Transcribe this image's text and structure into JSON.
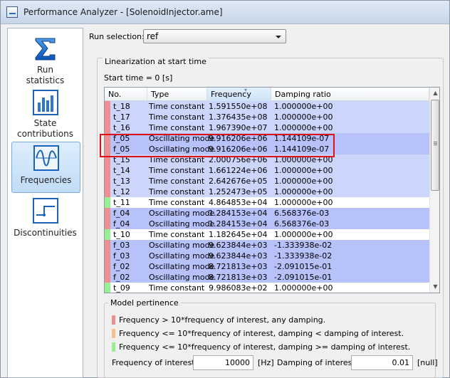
{
  "window": {
    "title": "Performance Analyzer - [SolenoidInjector.ame]",
    "icon": "performance-analyzer-icon"
  },
  "sidebar": {
    "items": [
      {
        "label": "Run\nstatistics",
        "icon": "sigma-icon"
      },
      {
        "label": "State\ncontributions",
        "icon": "bar-chart-icon"
      },
      {
        "label": "Frequencies",
        "icon": "wave-icon",
        "selected": true
      },
      {
        "label": "Discontinuities",
        "icon": "step-icon"
      }
    ]
  },
  "run_selection": {
    "label": "Run selection:",
    "value": "ref"
  },
  "linearization": {
    "title": "Linearization at start time",
    "start_time": "Start time = 0 [s]",
    "columns": [
      "No.",
      "Type",
      "Frequency",
      "Damping ratio"
    ],
    "rows": [
      {
        "no": "t_18",
        "type": "Time constant",
        "freq": "1.591550e+08",
        "damp": "1.000000e+00",
        "pertinence": "red",
        "selected": false
      },
      {
        "no": "t_17",
        "type": "Time constant",
        "freq": "1.376435e+08",
        "damp": "1.000000e+00",
        "pertinence": "red",
        "selected": false
      },
      {
        "no": "t_16",
        "type": "Time constant",
        "freq": "1.967390e+07",
        "damp": "1.000000e+00",
        "pertinence": "red",
        "selected": false
      },
      {
        "no": "f_05",
        "type": "Oscillating mode",
        "freq": "9.916206e+06",
        "damp": "1.144109e-07",
        "pertinence": "red",
        "selected": true
      },
      {
        "no": "f_05",
        "type": "Oscillating mode",
        "freq": "9.916206e+06",
        "damp": "1.144109e-07",
        "pertinence": "red",
        "selected": true
      },
      {
        "no": "t_15",
        "type": "Time constant",
        "freq": "2.000756e+06",
        "damp": "1.000000e+00",
        "pertinence": "red",
        "selected": false
      },
      {
        "no": "t_14",
        "type": "Time constant",
        "freq": "1.661224e+06",
        "damp": "1.000000e+00",
        "pertinence": "red",
        "selected": false
      },
      {
        "no": "t_13",
        "type": "Time constant",
        "freq": "2.642676e+05",
        "damp": "1.000000e+00",
        "pertinence": "red",
        "selected": false
      },
      {
        "no": "t_12",
        "type": "Time constant",
        "freq": "1.252473e+05",
        "damp": "1.000000e+00",
        "pertinence": "red",
        "selected": false
      },
      {
        "no": "t_11",
        "type": "Time constant",
        "freq": "4.864853e+04",
        "damp": "1.000000e+00",
        "pertinence": "green",
        "selected": false
      },
      {
        "no": "f_04",
        "type": "Oscillating mode",
        "freq": "1.284153e+04",
        "damp": "6.568376e-03",
        "pertinence": "red",
        "selected": true
      },
      {
        "no": "f_04",
        "type": "Oscillating mode",
        "freq": "1.284153e+04",
        "damp": "6.568376e-03",
        "pertinence": "red",
        "selected": true
      },
      {
        "no": "t_10",
        "type": "Time constant",
        "freq": "1.182645e+04",
        "damp": "1.000000e+00",
        "pertinence": "green",
        "selected": false
      },
      {
        "no": "f_03",
        "type": "Oscillating mode",
        "freq": "9.623844e+03",
        "damp": "-1.333938e-02",
        "pertinence": "red",
        "selected": true
      },
      {
        "no": "f_03",
        "type": "Oscillating mode",
        "freq": "9.623844e+03",
        "damp": "-1.333938e-02",
        "pertinence": "red",
        "selected": true
      },
      {
        "no": "f_02",
        "type": "Oscillating mode",
        "freq": "8.721813e+03",
        "damp": "-2.091015e-01",
        "pertinence": "red",
        "selected": true
      },
      {
        "no": "f_02",
        "type": "Oscillating mode",
        "freq": "8.721813e+03",
        "damp": "-2.091015e-01",
        "pertinence": "red",
        "selected": true
      },
      {
        "no": "t_09",
        "type": "Time constant",
        "freq": "9.986083e+02",
        "damp": "1.000000e+00",
        "pertinence": "green",
        "selected": false
      }
    ]
  },
  "model_pertinence": {
    "title": "Model pertinence",
    "legend": [
      {
        "color": "#ee8f92",
        "text": "Frequency > 10*frequency of interest, any damping."
      },
      {
        "color": "#f6c08e",
        "text": "Frequency <= 10*frequency of interest, damping < damping of interest."
      },
      {
        "color": "#98ef90",
        "text": "Frequency <= 10*frequency of interest, damping >= damping of interest."
      }
    ],
    "frequency_of_interest": {
      "label": "Frequency of interest:",
      "value": "10000",
      "unit": "[Hz]"
    },
    "damping_of_interest": {
      "label": "Damping of interest:",
      "value": "0.01",
      "unit": "[null]"
    }
  },
  "colors": {
    "marker_red": "#ee8f92",
    "marker_orange": "#f6c08e",
    "marker_green": "#98ef90",
    "row_selected": "#b7c2fa",
    "row_highlight_border": "#e0101a"
  }
}
